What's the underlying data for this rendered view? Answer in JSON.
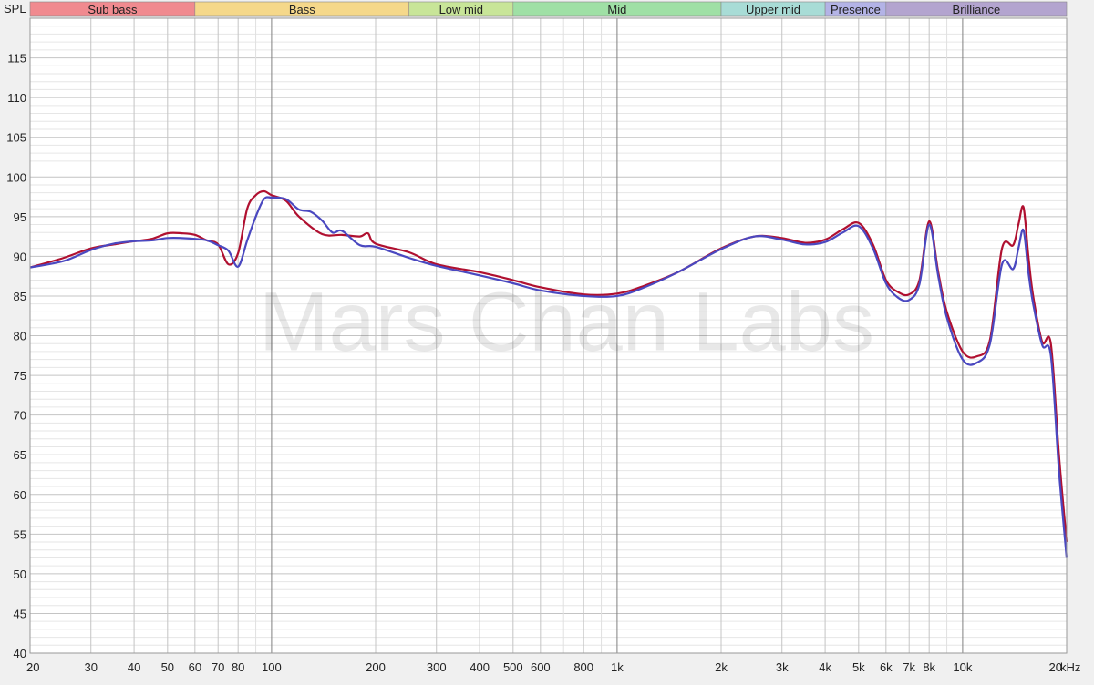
{
  "chart_data": {
    "type": "line",
    "title": "",
    "xlabel": "",
    "ylabel": "SPL",
    "x_unit": "kHz",
    "xscale": "log",
    "xlim": [
      20,
      20000
    ],
    "ylim": [
      40,
      120
    ],
    "grid": true,
    "watermark": "Mars Chan Labs",
    "x_ticks": [
      {
        "value": 20,
        "label": "20"
      },
      {
        "value": 30,
        "label": "30"
      },
      {
        "value": 40,
        "label": "40"
      },
      {
        "value": 50,
        "label": "50"
      },
      {
        "value": 60,
        "label": "60"
      },
      {
        "value": 70,
        "label": "70"
      },
      {
        "value": 80,
        "label": "80"
      },
      {
        "value": 100,
        "label": "100"
      },
      {
        "value": 200,
        "label": "200"
      },
      {
        "value": 300,
        "label": "300"
      },
      {
        "value": 400,
        "label": "400"
      },
      {
        "value": 500,
        "label": "500"
      },
      {
        "value": 600,
        "label": "600"
      },
      {
        "value": 800,
        "label": "800"
      },
      {
        "value": 1000,
        "label": "1k"
      },
      {
        "value": 2000,
        "label": "2k"
      },
      {
        "value": 3000,
        "label": "3k"
      },
      {
        "value": 4000,
        "label": "4k"
      },
      {
        "value": 5000,
        "label": "5k"
      },
      {
        "value": 6000,
        "label": "6k"
      },
      {
        "value": 7000,
        "label": "7k"
      },
      {
        "value": 8000,
        "label": "8k"
      },
      {
        "value": 10000,
        "label": "10k"
      },
      {
        "value": 20000,
        "label": "20"
      }
    ],
    "y_ticks": [
      40,
      45,
      50,
      55,
      60,
      65,
      70,
      75,
      80,
      85,
      90,
      95,
      100,
      105,
      110,
      115
    ],
    "bands": [
      {
        "label": "Sub bass",
        "from": 20,
        "to": 60,
        "color": "#f08a8f"
      },
      {
        "label": "Bass",
        "from": 60,
        "to": 250,
        "color": "#f5d88a"
      },
      {
        "label": "Low mid",
        "from": 250,
        "to": 500,
        "color": "#c8e598"
      },
      {
        "label": "Mid",
        "from": 500,
        "to": 2000,
        "color": "#9fe0a5"
      },
      {
        "label": "Upper mid",
        "from": 2000,
        "to": 4000,
        "color": "#a8dcd6"
      },
      {
        "label": "Presence",
        "from": 4000,
        "to": 6000,
        "color": "#b3b3e6"
      },
      {
        "label": "Brilliance",
        "from": 6000,
        "to": 20000,
        "color": "#b3a4cf"
      }
    ],
    "series": [
      {
        "color": "#b01030",
        "x": [
          20,
          25,
          30,
          35,
          40,
          45,
          50,
          55,
          60,
          65,
          70,
          75,
          80,
          85,
          90,
          95,
          100,
          110,
          120,
          140,
          160,
          180,
          190,
          200,
          250,
          300,
          400,
          500,
          600,
          800,
          1000,
          1200,
          1500,
          2000,
          2500,
          3000,
          3500,
          4000,
          4500,
          5000,
          5500,
          6000,
          6500,
          7000,
          7500,
          8000,
          8500,
          9000,
          10000,
          11000,
          12000,
          13000,
          14000,
          14500,
          15000,
          15500,
          16000,
          17000,
          18000,
          19000,
          20000
        ],
        "y": [
          88.6,
          89.8,
          91.0,
          91.5,
          91.9,
          92.2,
          92.9,
          92.9,
          92.7,
          92.0,
          91.5,
          89.0,
          90.4,
          96.0,
          97.7,
          98.2,
          97.7,
          97.0,
          95.0,
          92.8,
          92.7,
          92.5,
          92.9,
          91.6,
          90.5,
          89.0,
          88.0,
          87.0,
          86.1,
          85.2,
          85.3,
          86.3,
          88.0,
          91.0,
          92.5,
          92.3,
          91.7,
          92.1,
          93.4,
          94.2,
          91.5,
          87.0,
          85.5,
          85.2,
          87.0,
          94.4,
          88.0,
          83.0,
          78.0,
          77.4,
          79.5,
          91.0,
          91.4,
          94.0,
          96.2,
          90.0,
          85.0,
          79.2,
          79.0,
          65.0,
          54.0
        ]
      },
      {
        "color": "#4a48c0",
        "x": [
          20,
          25,
          30,
          35,
          40,
          45,
          50,
          55,
          60,
          65,
          70,
          75,
          80,
          85,
          90,
          95,
          100,
          110,
          120,
          130,
          140,
          150,
          160,
          180,
          200,
          250,
          300,
          400,
          500,
          600,
          800,
          1000,
          1200,
          1500,
          2000,
          2500,
          3000,
          3500,
          4000,
          4500,
          5000,
          5500,
          6000,
          6500,
          7000,
          7500,
          8000,
          8500,
          9000,
          10000,
          11000,
          12000,
          13000,
          14000,
          14500,
          15000,
          15500,
          16000,
          17000,
          18000,
          19000,
          20000
        ],
        "y": [
          88.6,
          89.4,
          90.8,
          91.6,
          91.9,
          92.0,
          92.3,
          92.3,
          92.2,
          92.0,
          91.4,
          90.7,
          88.7,
          92.0,
          95.0,
          97.2,
          97.4,
          97.2,
          95.9,
          95.6,
          94.5,
          93.0,
          93.2,
          91.4,
          91.2,
          89.8,
          88.8,
          87.6,
          86.6,
          85.7,
          85.0,
          85.0,
          86.1,
          88.0,
          90.9,
          92.5,
          92.1,
          91.5,
          91.8,
          93.0,
          93.8,
          91.0,
          86.6,
          84.8,
          84.5,
          86.5,
          94.0,
          87.5,
          82.3,
          77.0,
          76.6,
          79.0,
          89.0,
          88.4,
          91.0,
          93.3,
          88.0,
          84.0,
          78.8,
          77.5,
          63.0,
          52.0
        ]
      }
    ]
  }
}
